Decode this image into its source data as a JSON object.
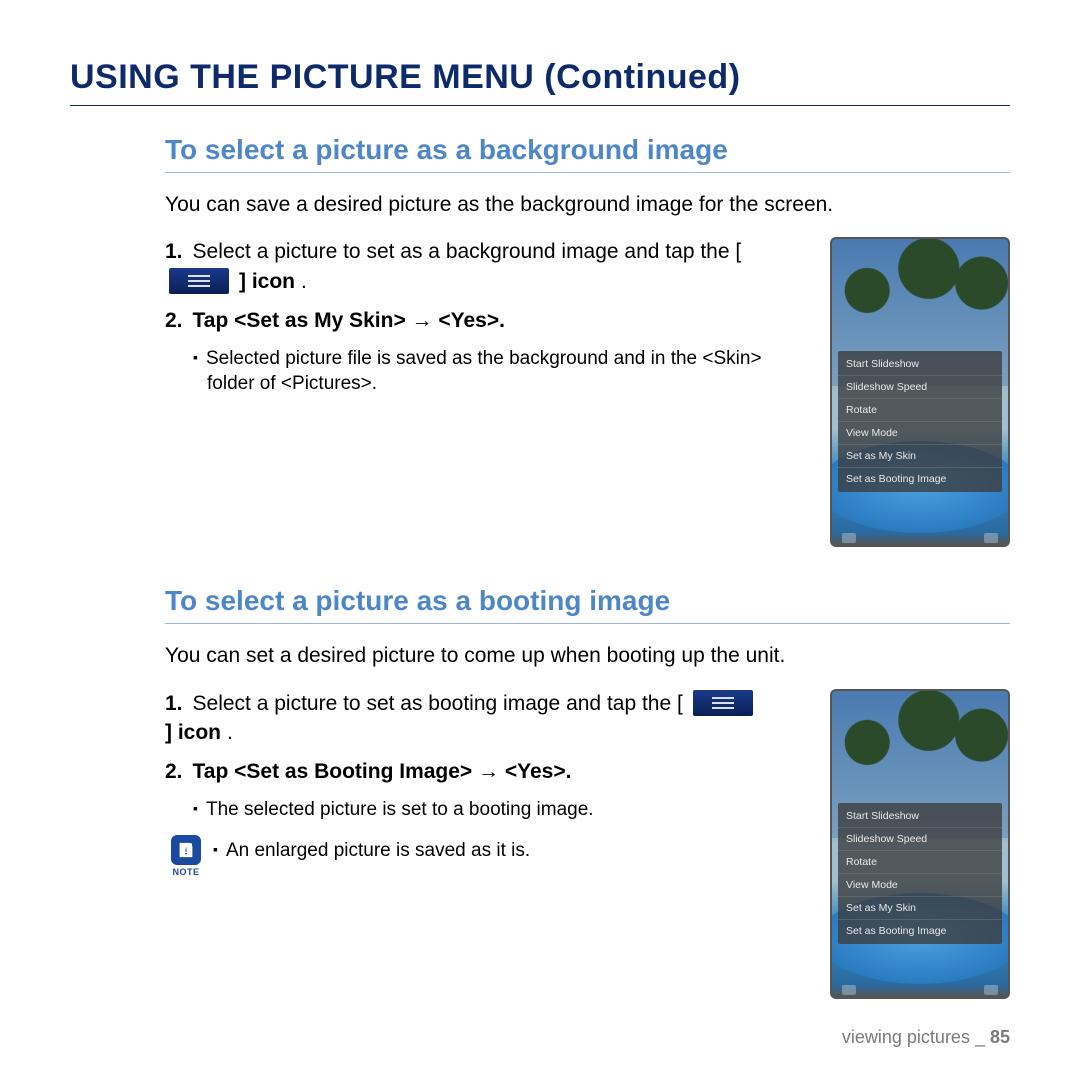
{
  "page_title": "USING THE PICTURE MENU (Continued)",
  "section1": {
    "heading": "To select a picture as a background image",
    "intro": "You can save a desired picture as the background image for the screen.",
    "step1_num": "1.",
    "step1_a": "Select a picture to set as a background image and tap the [",
    "step1_b": "] icon",
    "step2_num": "2.",
    "step2_text": "Tap <Set as My Skin> → <Yes>.",
    "bullet1": "Selected picture file is saved as the background and in the <Skin> folder of <Pictures>."
  },
  "section2": {
    "heading": "To select a picture as a booting image",
    "intro": "You can set a desired picture to come up when booting up the unit.",
    "step1_num": "1.",
    "step1_a": "Select a picture to set as booting image and tap the [",
    "step1_b": "] icon",
    "step2_num": "2.",
    "step2_text": "Tap <Set as Booting Image> → <Yes>.",
    "bullet1": "The selected picture is set to a booting image.",
    "note_label": "NOTE",
    "note_text": "An enlarged picture is saved as it is."
  },
  "device_menu": {
    "items": [
      "Start Slideshow",
      "Slideshow Speed",
      "Rotate",
      "View Mode",
      "Set as My Skin",
      "Set as Booting Image"
    ]
  },
  "footer": {
    "text": "viewing pictures _ ",
    "page": "85"
  },
  "period": "."
}
